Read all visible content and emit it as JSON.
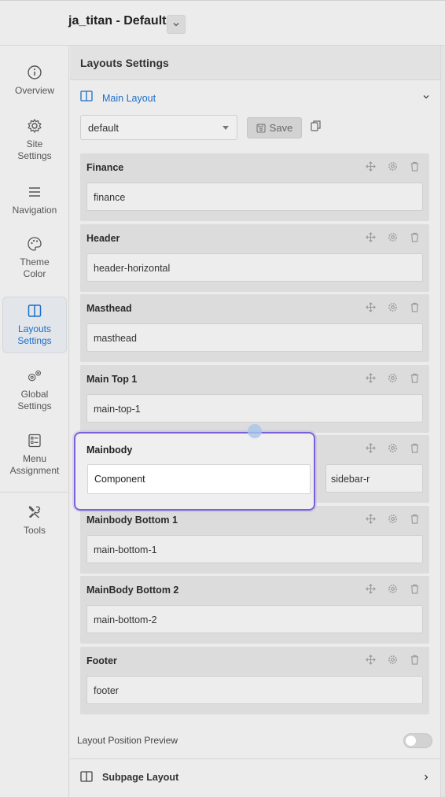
{
  "header": {
    "title": "ja_titan - Default"
  },
  "sidebar": {
    "items": [
      {
        "label": "Overview"
      },
      {
        "label": "Site Settings"
      },
      {
        "label": "Navigation"
      },
      {
        "label": "Theme Color"
      },
      {
        "label": "Layouts Settings"
      },
      {
        "label": "Global Settings"
      },
      {
        "label": "Menu Assignment"
      },
      {
        "label": "Tools"
      }
    ]
  },
  "main": {
    "title": "Layouts Settings",
    "main_layout_label": "Main Layout",
    "layout_select": "default",
    "save_label": "Save",
    "blocks": [
      {
        "name": "Finance",
        "position": "finance"
      },
      {
        "name": "Header",
        "position": "header-horizontal"
      },
      {
        "name": "Masthead",
        "position": "masthead"
      },
      {
        "name": "Main Top 1",
        "position": "main-top-1"
      },
      {
        "name": "Mainbody",
        "position": "Component",
        "position_right": "sidebar-r"
      },
      {
        "name": "Mainbody Bottom 1",
        "position": "main-bottom-1"
      },
      {
        "name": "MainBody Bottom 2",
        "position": "main-bottom-2"
      },
      {
        "name": "Footer",
        "position": "footer"
      }
    ],
    "preview_label": "Layout Position Preview",
    "subpage_label": "Subpage Layout"
  },
  "colors": {
    "accent": "#1d6fc9",
    "drag_border": "#7b61d9"
  }
}
